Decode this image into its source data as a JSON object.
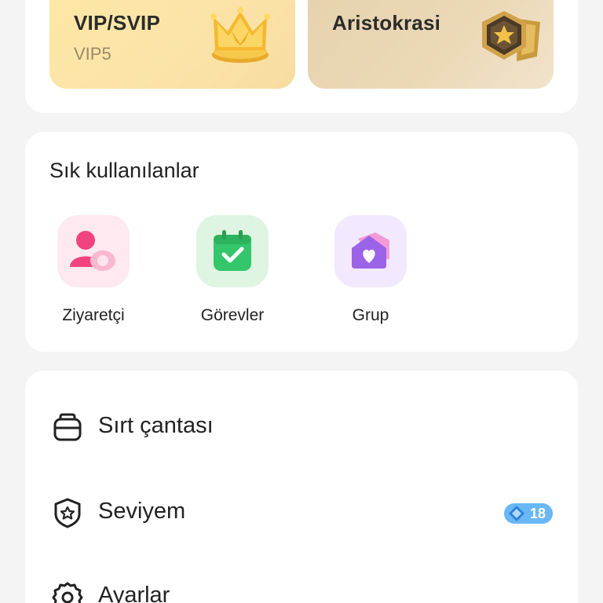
{
  "membership": {
    "vip": {
      "title": "VIP/SVIP",
      "level": "VIP5"
    },
    "aristocracy": {
      "title": "Aristokrasi"
    }
  },
  "favorites": {
    "title": "Sık kullanılanlar",
    "items": [
      {
        "label": "Ziyaretçi",
        "icon": "visitor-icon",
        "color": "#f0437f"
      },
      {
        "label": "Görevler",
        "icon": "tasks-icon",
        "color": "#34c66a"
      },
      {
        "label": "Grup",
        "icon": "group-icon",
        "color": "#9b63e8"
      }
    ]
  },
  "menu": {
    "items": [
      {
        "label": "Sırt çantası",
        "icon": "backpack-icon"
      },
      {
        "label": "Seviyem",
        "icon": "level-shield-icon",
        "badge": "18"
      },
      {
        "label": "Ayarlar",
        "icon": "settings-gear-icon"
      }
    ]
  },
  "colors": {
    "background": "#f4f4f4",
    "card": "#ffffff",
    "vip_tile": "#fde7a6",
    "aristo_tile": "#e9d5b2",
    "badge": "#69b8f5"
  }
}
